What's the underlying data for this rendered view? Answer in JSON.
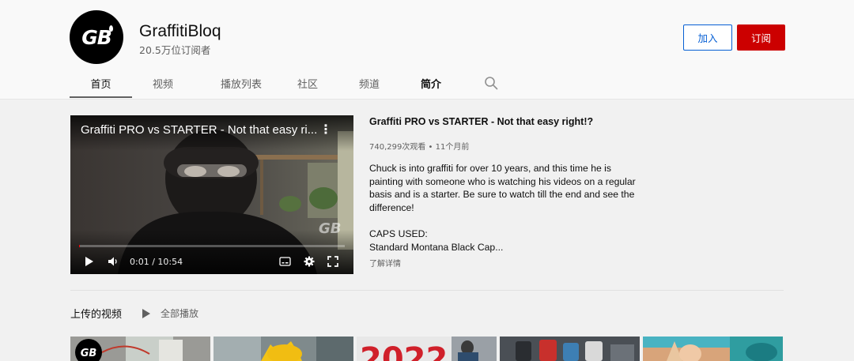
{
  "channel": {
    "name": "GraffitiBloq",
    "subscribers": "20.5万位订阅者",
    "avatar_text": "GB",
    "join_label": "加入",
    "subscribe_label": "订阅"
  },
  "tabs": [
    {
      "label": "首页"
    },
    {
      "label": "视频"
    },
    {
      "label": "播放列表"
    },
    {
      "label": "社区"
    },
    {
      "label": "频道"
    },
    {
      "label": "简介"
    }
  ],
  "featured": {
    "player_title": "Graffiti PRO vs STARTER - Not that easy ri...",
    "watermark": "GB",
    "time": "0:01 / 10:54",
    "progress_percent": 0.2,
    "title": "Graffiti PRO vs STARTER - Not that easy right!?",
    "meta": "740,299次观看 • 11个月前",
    "description_lines": [
      "Chuck is into graffiti for over 10 years, and this time he is",
      "painting with someone who is watching his videos on a regular",
      "basis and is a starter. Be sure to watch till the end and see the",
      "difference!",
      "",
      "CAPS USED:",
      "Standard Montana Black Cap..."
    ],
    "read_more": "了解详情"
  },
  "uploads": {
    "title": "上传的视频",
    "play_all": "全部播放",
    "thumb_text_1": "GB",
    "thumb_text_3": "2022"
  },
  "colors": {
    "accent_blue": "#065fd4",
    "subscribe_red": "#cc0000",
    "progress_red": "#ff0000"
  },
  "icons": [
    "search-icon",
    "more-vert-icon",
    "play-icon",
    "volume-icon",
    "captions-icon",
    "settings-icon",
    "fullscreen-icon",
    "play-all-icon"
  ]
}
